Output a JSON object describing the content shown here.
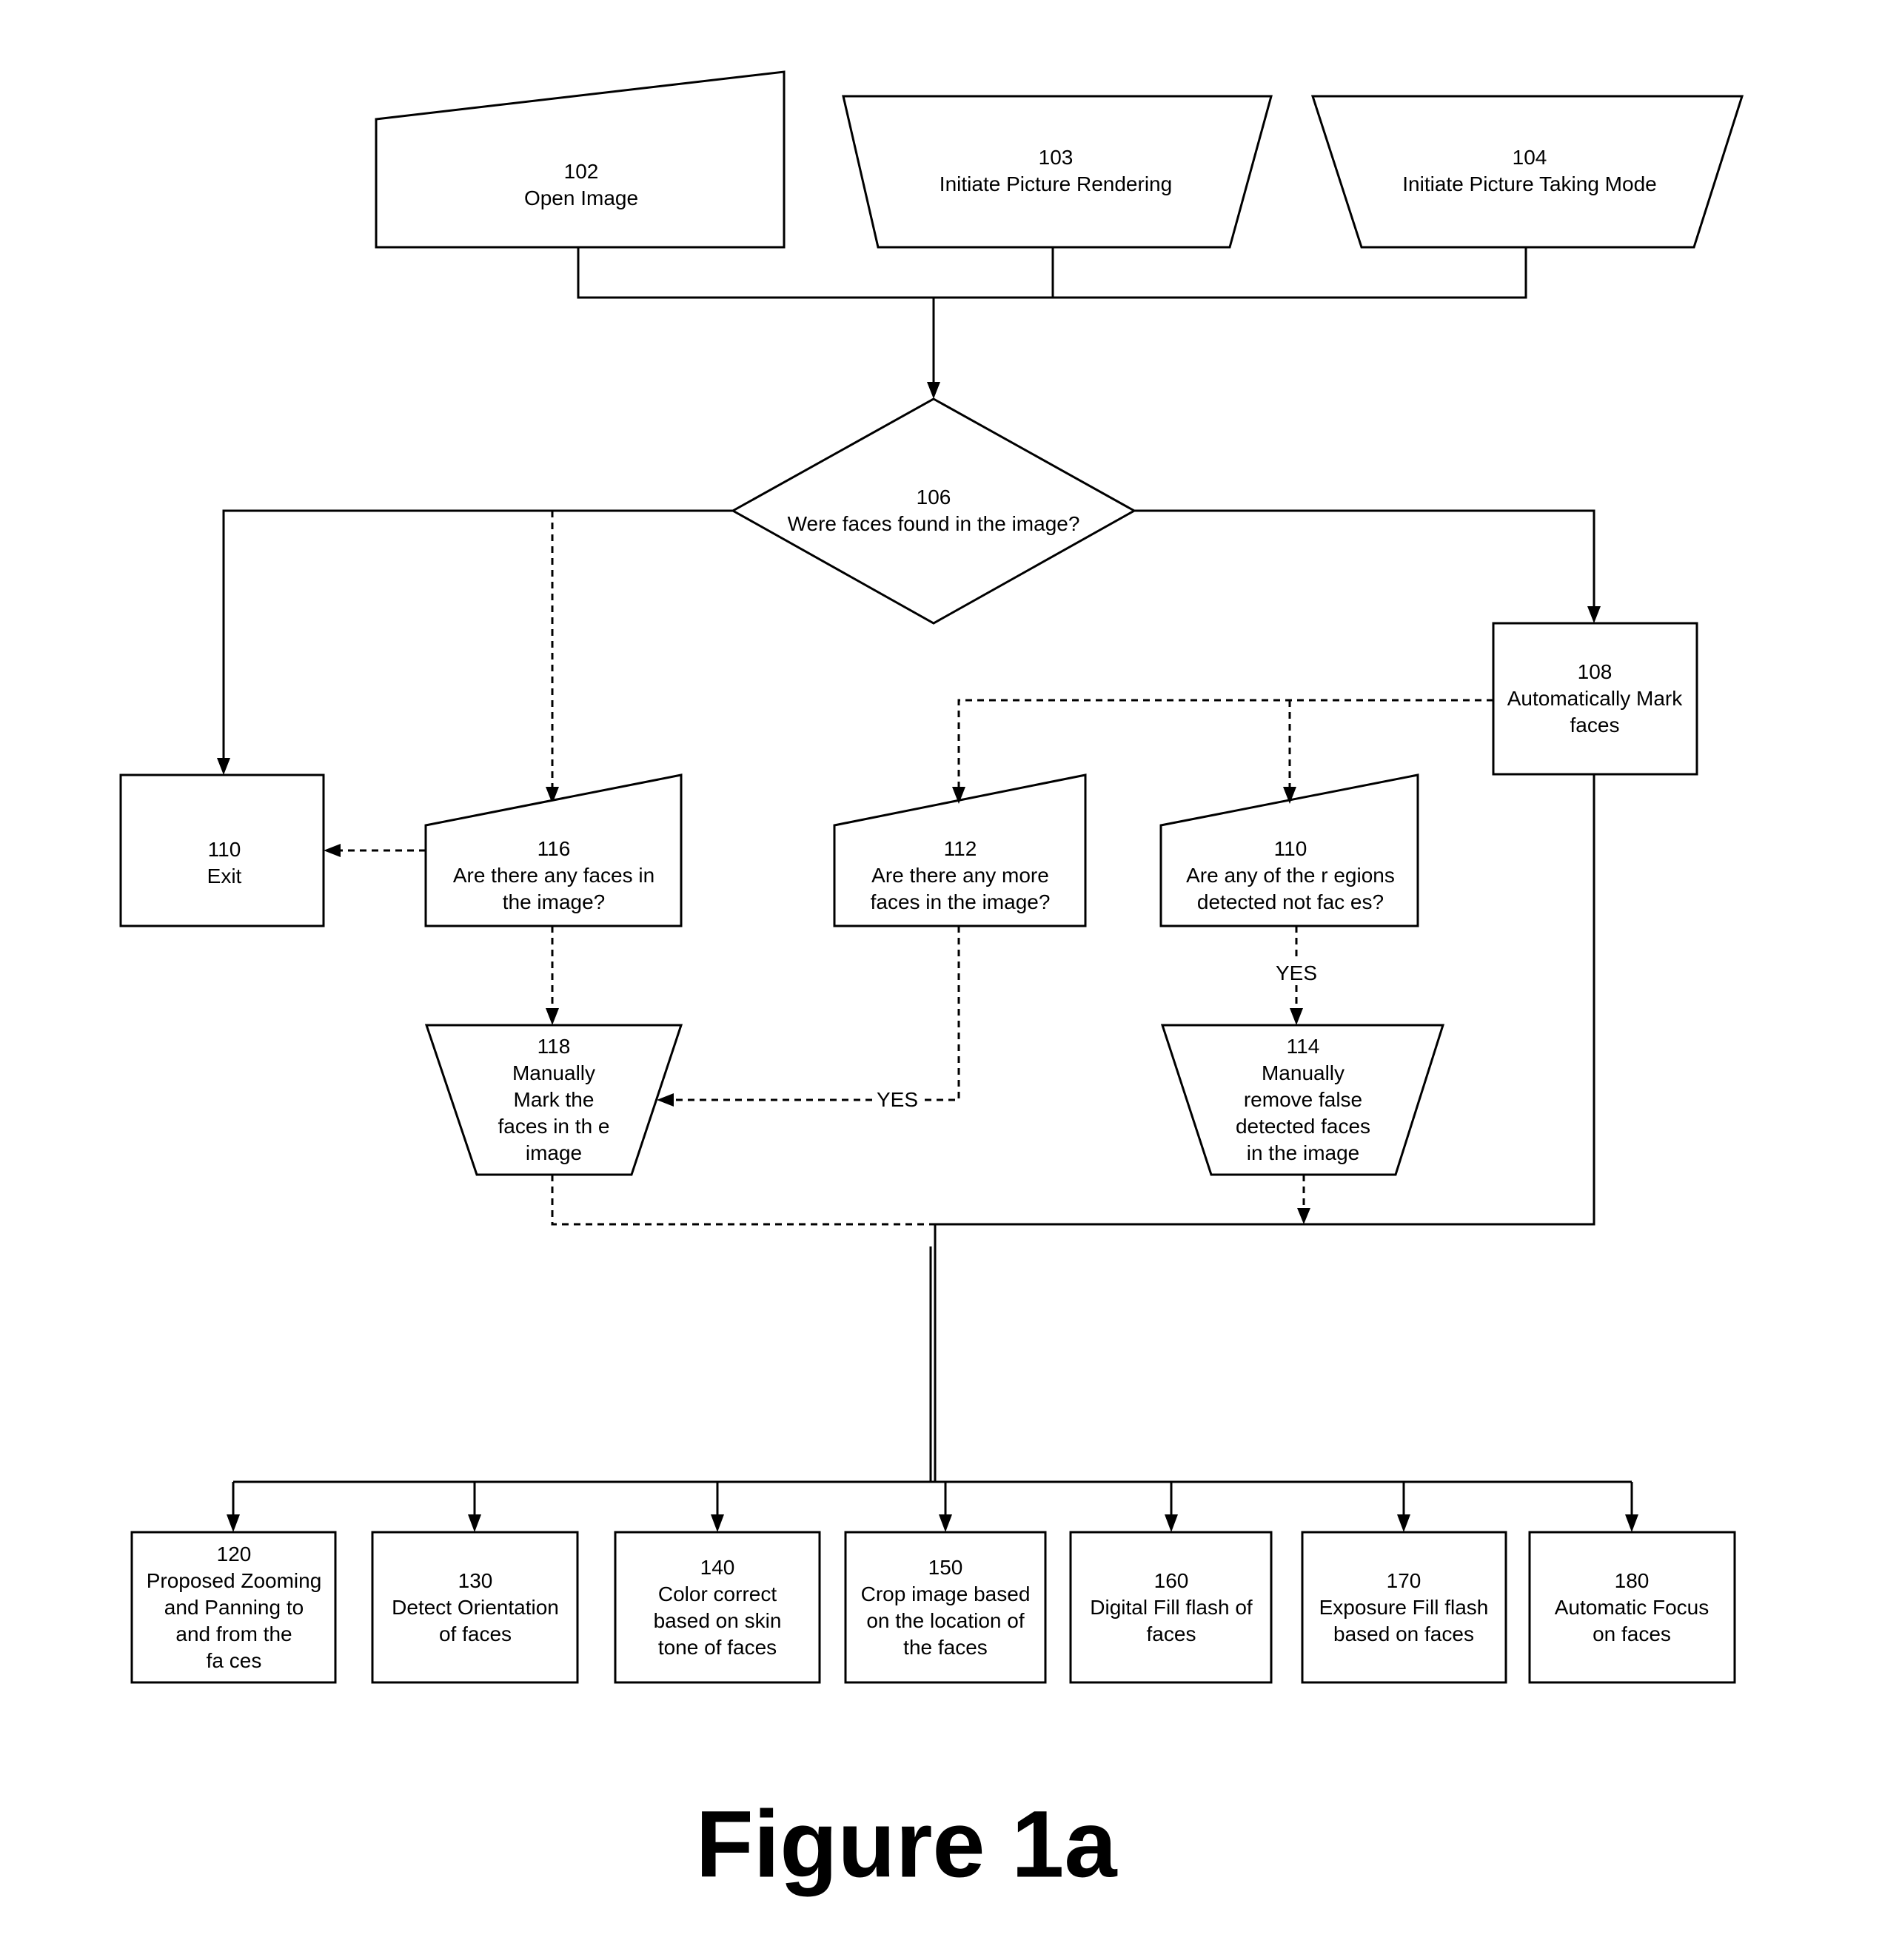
{
  "figure": {
    "caption": "Figure 1a",
    "nodes": {
      "n102": {
        "id": "102",
        "text": "Open Image",
        "shape": "manual-input"
      },
      "n103": {
        "id": "103",
        "text": "Initiate Picture Rendering",
        "shape": "manual-operation"
      },
      "n104": {
        "id": "104",
        "text": "Initiate Picture Taking Mode",
        "shape": "manual-operation"
      },
      "n106": {
        "id": "106",
        "text": "Were faces found in the image?",
        "shape": "decision"
      },
      "n108": {
        "id": "108",
        "text": "Automatically Mark\nfaces",
        "shape": "process"
      },
      "n110exit": {
        "id": "110",
        "text": "Exit",
        "shape": "process"
      },
      "n116": {
        "id": "116",
        "text": "Are there any  faces in\nthe image?",
        "shape": "manual-input"
      },
      "n112": {
        "id": "112",
        "text": "Are there any more\nfaces in the image?",
        "shape": "manual-input"
      },
      "n110q": {
        "id": "110",
        "text": "Are any of the r egions\ndetected not fac es?",
        "shape": "manual-input"
      },
      "n118": {
        "id": "118",
        "text": "Manually\nMark the\nfaces in th e\nimage",
        "shape": "manual-operation"
      },
      "n114": {
        "id": "114",
        "text": "Manually\nremove false\ndetected faces\nin the image",
        "shape": "manual-operation"
      },
      "n120": {
        "id": "120",
        "text": "Proposed Zooming\nand Panning to\nand from the\nfa ces",
        "shape": "process"
      },
      "n130": {
        "id": "130",
        "text": "Detect Orientation\nof faces",
        "shape": "process"
      },
      "n140": {
        "id": "140",
        "text": "Color correct\nbased on skin\ntone of faces",
        "shape": "process"
      },
      "n150": {
        "id": "150",
        "text": "Crop image based\non the location of\nthe faces",
        "shape": "process"
      },
      "n160": {
        "id": "160",
        "text": "Digital Fill flash of\nfaces",
        "shape": "process"
      },
      "n170": {
        "id": "170",
        "text": "Exposure Fill flash\nbased on   faces",
        "shape": "process"
      },
      "n180": {
        "id": "180",
        "text": "Automatic Focus\non faces",
        "shape": "process"
      }
    },
    "edge_labels": {
      "yes_112_to_118": "YES",
      "yes_110_to_114": "YES"
    }
  }
}
